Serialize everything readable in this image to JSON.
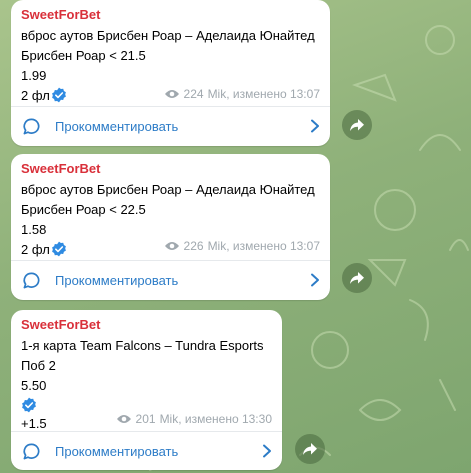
{
  "colors": {
    "sender": "#d9303a",
    "link": "#2d7cc7",
    "meta": "#a0a8ae",
    "verified": "#2f8be2",
    "wallpaper": "#8fb17a"
  },
  "icons": [
    "eye-icon",
    "verified-check-icon",
    "comment-icon",
    "chevron-right-icon",
    "share-icon"
  ],
  "posts": [
    {
      "sender": "SweetForBet",
      "lines": [
        "вброс аутов Брисбен Роар – Аделаида Юнайтед",
        "Брисбен Роар < 21.5",
        "1.99",
        "2 фл"
      ],
      "views": "224",
      "footer": "Mik, изменено 13:07",
      "comment_label": "Прокомментировать"
    },
    {
      "sender": "SweetForBet",
      "lines": [
        "вброс аутов Брисбен Роар – Аделаида Юнайтед",
        "Брисбен Роар < 22.5",
        "1.58",
        "2 фл"
      ],
      "views": "226",
      "footer": "Mik, изменено 13:07",
      "comment_label": "Прокомментировать"
    },
    {
      "sender": "SweetForBet",
      "lines": [
        "1-я карта Team Falcons – Tundra Esports",
        "Поб 2",
        "5.50",
        "",
        "+1.5"
      ],
      "views": "201",
      "footer": "Mik, изменено 13:30",
      "comment_label": "Прокомментировать"
    }
  ]
}
